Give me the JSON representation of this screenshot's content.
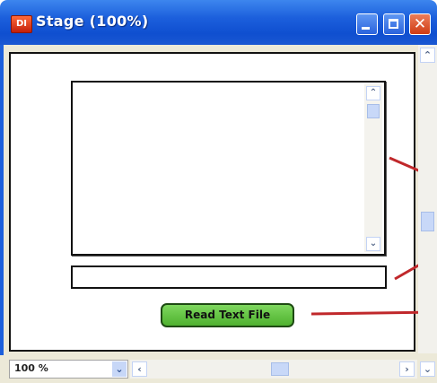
{
  "window": {
    "title": "Stage (100%)",
    "app_icon_text": "DI",
    "minimize_glyph": "minimize-icon",
    "maximize_glyph": "maximize-icon",
    "close_glyph": "✕"
  },
  "stage": {
    "read_button_label": "Read Text File",
    "callout_color": "#c0282b"
  },
  "scrollbars": {
    "up_arrow": "⌃",
    "down_arrow": "⌄",
    "left_arrow": "‹",
    "right_arrow": "›"
  },
  "bottom_bar": {
    "zoom_value": "100 %",
    "zoom_dropdown_arrow": "⌄"
  },
  "colors": {
    "titlebar": "#1c5fdc",
    "button_green": "#6cc84b",
    "close_button": "#d94a22"
  }
}
